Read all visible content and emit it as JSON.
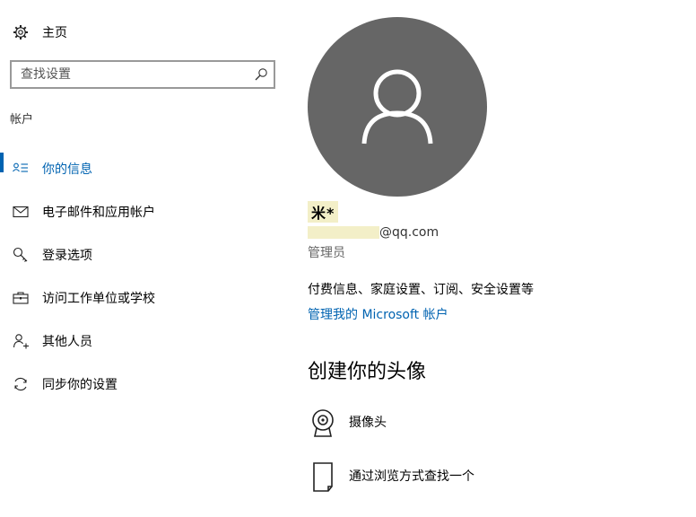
{
  "sidebar": {
    "home_label": "主页",
    "search_placeholder": "查找设置",
    "section_title": "帐户",
    "items": [
      {
        "label": "你的信息",
        "icon": "person-list-icon",
        "active": true
      },
      {
        "label": "电子邮件和应用帐户",
        "icon": "mail-icon"
      },
      {
        "label": "登录选项",
        "icon": "key-icon"
      },
      {
        "label": "访问工作单位或学校",
        "icon": "briefcase-icon"
      },
      {
        "label": "其他人员",
        "icon": "add-person-icon"
      },
      {
        "label": "同步你的设置",
        "icon": "sync-icon"
      }
    ]
  },
  "main": {
    "username": "米*",
    "email_suffix": "@qq.com",
    "role": "管理员",
    "billing_text": "付费信息、家庭设置、订阅、安全设置等",
    "manage_link": "管理我的 Microsoft 帐户",
    "create_heading": "创建你的头像",
    "options": [
      {
        "label": "摄像头",
        "icon": "webcam-icon"
      },
      {
        "label": "通过浏览方式查找一个",
        "icon": "document-icon"
      }
    ]
  },
  "colors": {
    "accent": "#0063b1",
    "avatar_bg": "#666666",
    "redaction": "#f3efc8"
  }
}
